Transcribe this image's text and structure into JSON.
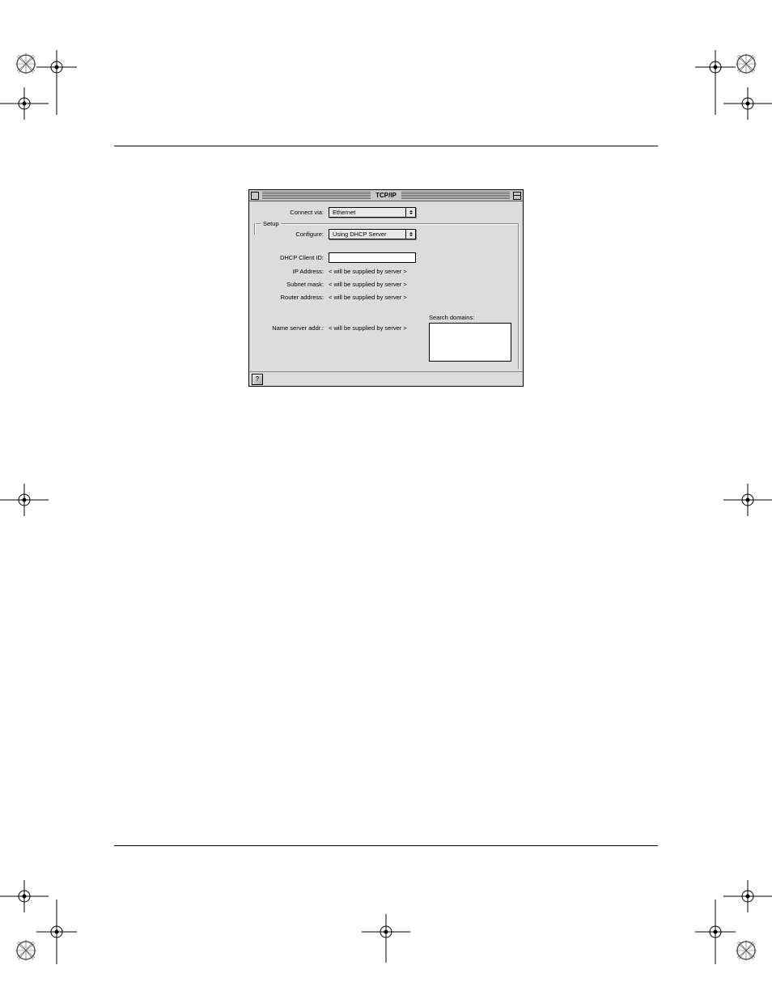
{
  "window": {
    "title": "TCP/IP",
    "connectVia": {
      "label": "Connect via:",
      "value": "Ethernet"
    },
    "setupLabel": "Setup",
    "configure": {
      "label": "Configure:",
      "value": "Using DHCP Server"
    },
    "dhcpClientId": {
      "label": "DHCP Client ID:"
    },
    "ipAddress": {
      "label": "IP Address:",
      "value": "< will be supplied by server >"
    },
    "subnetMask": {
      "label": "Subnet mask:",
      "value": "< will be supplied by server >"
    },
    "routerAddress": {
      "label": "Router address:",
      "value": "< will be supplied by server >"
    },
    "nameServerAddr": {
      "label": "Name server addr.:",
      "value": "< will be supplied by server >"
    },
    "searchDomains": {
      "label": "Search domains:"
    }
  }
}
